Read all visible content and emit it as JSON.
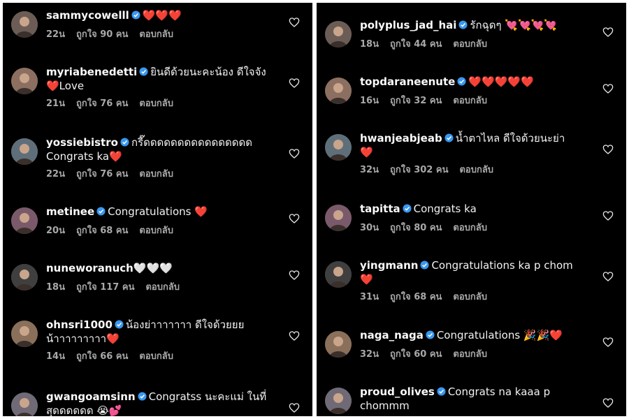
{
  "colors": {
    "background": "#000000",
    "text": "#f2f2f2",
    "meta": "#a8a8a8",
    "verified": "#3897f0",
    "heart": "#ed1c24"
  },
  "left": [
    {
      "username": "sammycowelll",
      "verified": true,
      "line1": "❤️❤️❤️",
      "line2": "",
      "time": "22น",
      "likes": "ถูกใจ 90 คน",
      "reply": "ตอบกลับ"
    },
    {
      "username": "myriabenedetti",
      "verified": true,
      "line1": "ยินดีด้วยนะคะน้อง ดีใจจัง",
      "line2": "❤️Love",
      "time": "21น",
      "likes": "ถูกใจ 76 คน",
      "reply": "ตอบกลับ"
    },
    {
      "username": "yossiebistro",
      "verified": true,
      "line1": "กรี๊ดดดดดดดดดดดดดดดด",
      "line2": "Congrats ka❤️",
      "time": "22น",
      "likes": "ถูกใจ 76 คน",
      "reply": "ตอบกลับ"
    },
    {
      "username": "metinee",
      "verified": true,
      "line1": "Congratulations ❤️",
      "line2": "",
      "time": "20น",
      "likes": "ถูกใจ 68 คน",
      "reply": "ตอบกลับ"
    },
    {
      "username": "nuneworanuch",
      "verified": false,
      "line1": "🤍🤍🤍",
      "line2": "",
      "time": "18น",
      "likes": "ถูกใจ 117 คน",
      "reply": "ตอบกลับ"
    },
    {
      "username": "ohnsri1000",
      "verified": true,
      "line1": "น้องย่าาาาาาา ดีใจด้วยยย",
      "line2": "น้าาาาาาาาา❤️",
      "time": "14น",
      "likes": "ถูกใจ 66 คน",
      "reply": "ตอบกลับ"
    },
    {
      "username": "gwangoamsinn",
      "verified": true,
      "line1": "Congratss นะคะแม่ ในที่",
      "line2": "สุดดดดดด 😭💕",
      "time": "",
      "likes": "",
      "reply": ""
    }
  ],
  "right": [
    {
      "username": "polyplus_jad_hai",
      "verified": true,
      "line1": "รักฉุดๆ 💘💘💘💘",
      "line2": "",
      "time": "18น",
      "likes": "ถูกใจ 44 คน",
      "reply": "ตอบกลับ"
    },
    {
      "username": "topdaraneenute",
      "verified": true,
      "line1": "❤️❤️❤️❤️❤️",
      "line2": "",
      "time": "16น",
      "likes": "ถูกใจ 32 คน",
      "reply": "ตอบกลับ"
    },
    {
      "username": "hwanjeabjeab",
      "verified": true,
      "line1": "น้ำตาไหล ดีใจด้วยนะย่า",
      "line2": "❤️",
      "time": "32น",
      "likes": "ถูกใจ 302 คน",
      "reply": "ตอบกลับ"
    },
    {
      "username": "tapitta",
      "verified": true,
      "line1": "Congrats ka",
      "line2": "",
      "time": "30น",
      "likes": "ถูกใจ 80 คน",
      "reply": "ตอบกลับ"
    },
    {
      "username": "yingmann",
      "verified": true,
      "line1": "Congratulations ka p chom",
      "line2": "❤️",
      "time": "31น",
      "likes": "ถูกใจ 68 คน",
      "reply": "ตอบกลับ"
    },
    {
      "username": "naga_naga",
      "verified": true,
      "line1": "Congratulations 🎉🎉❤️",
      "line2": "",
      "time": "32น",
      "likes": "ถูกใจ 60 คน",
      "reply": "ตอบกลับ"
    },
    {
      "username": "proud_olives",
      "verified": true,
      "line1": "Congrats na kaaa p",
      "line2": "chommm",
      "time": "",
      "likes": "",
      "reply": ""
    }
  ]
}
